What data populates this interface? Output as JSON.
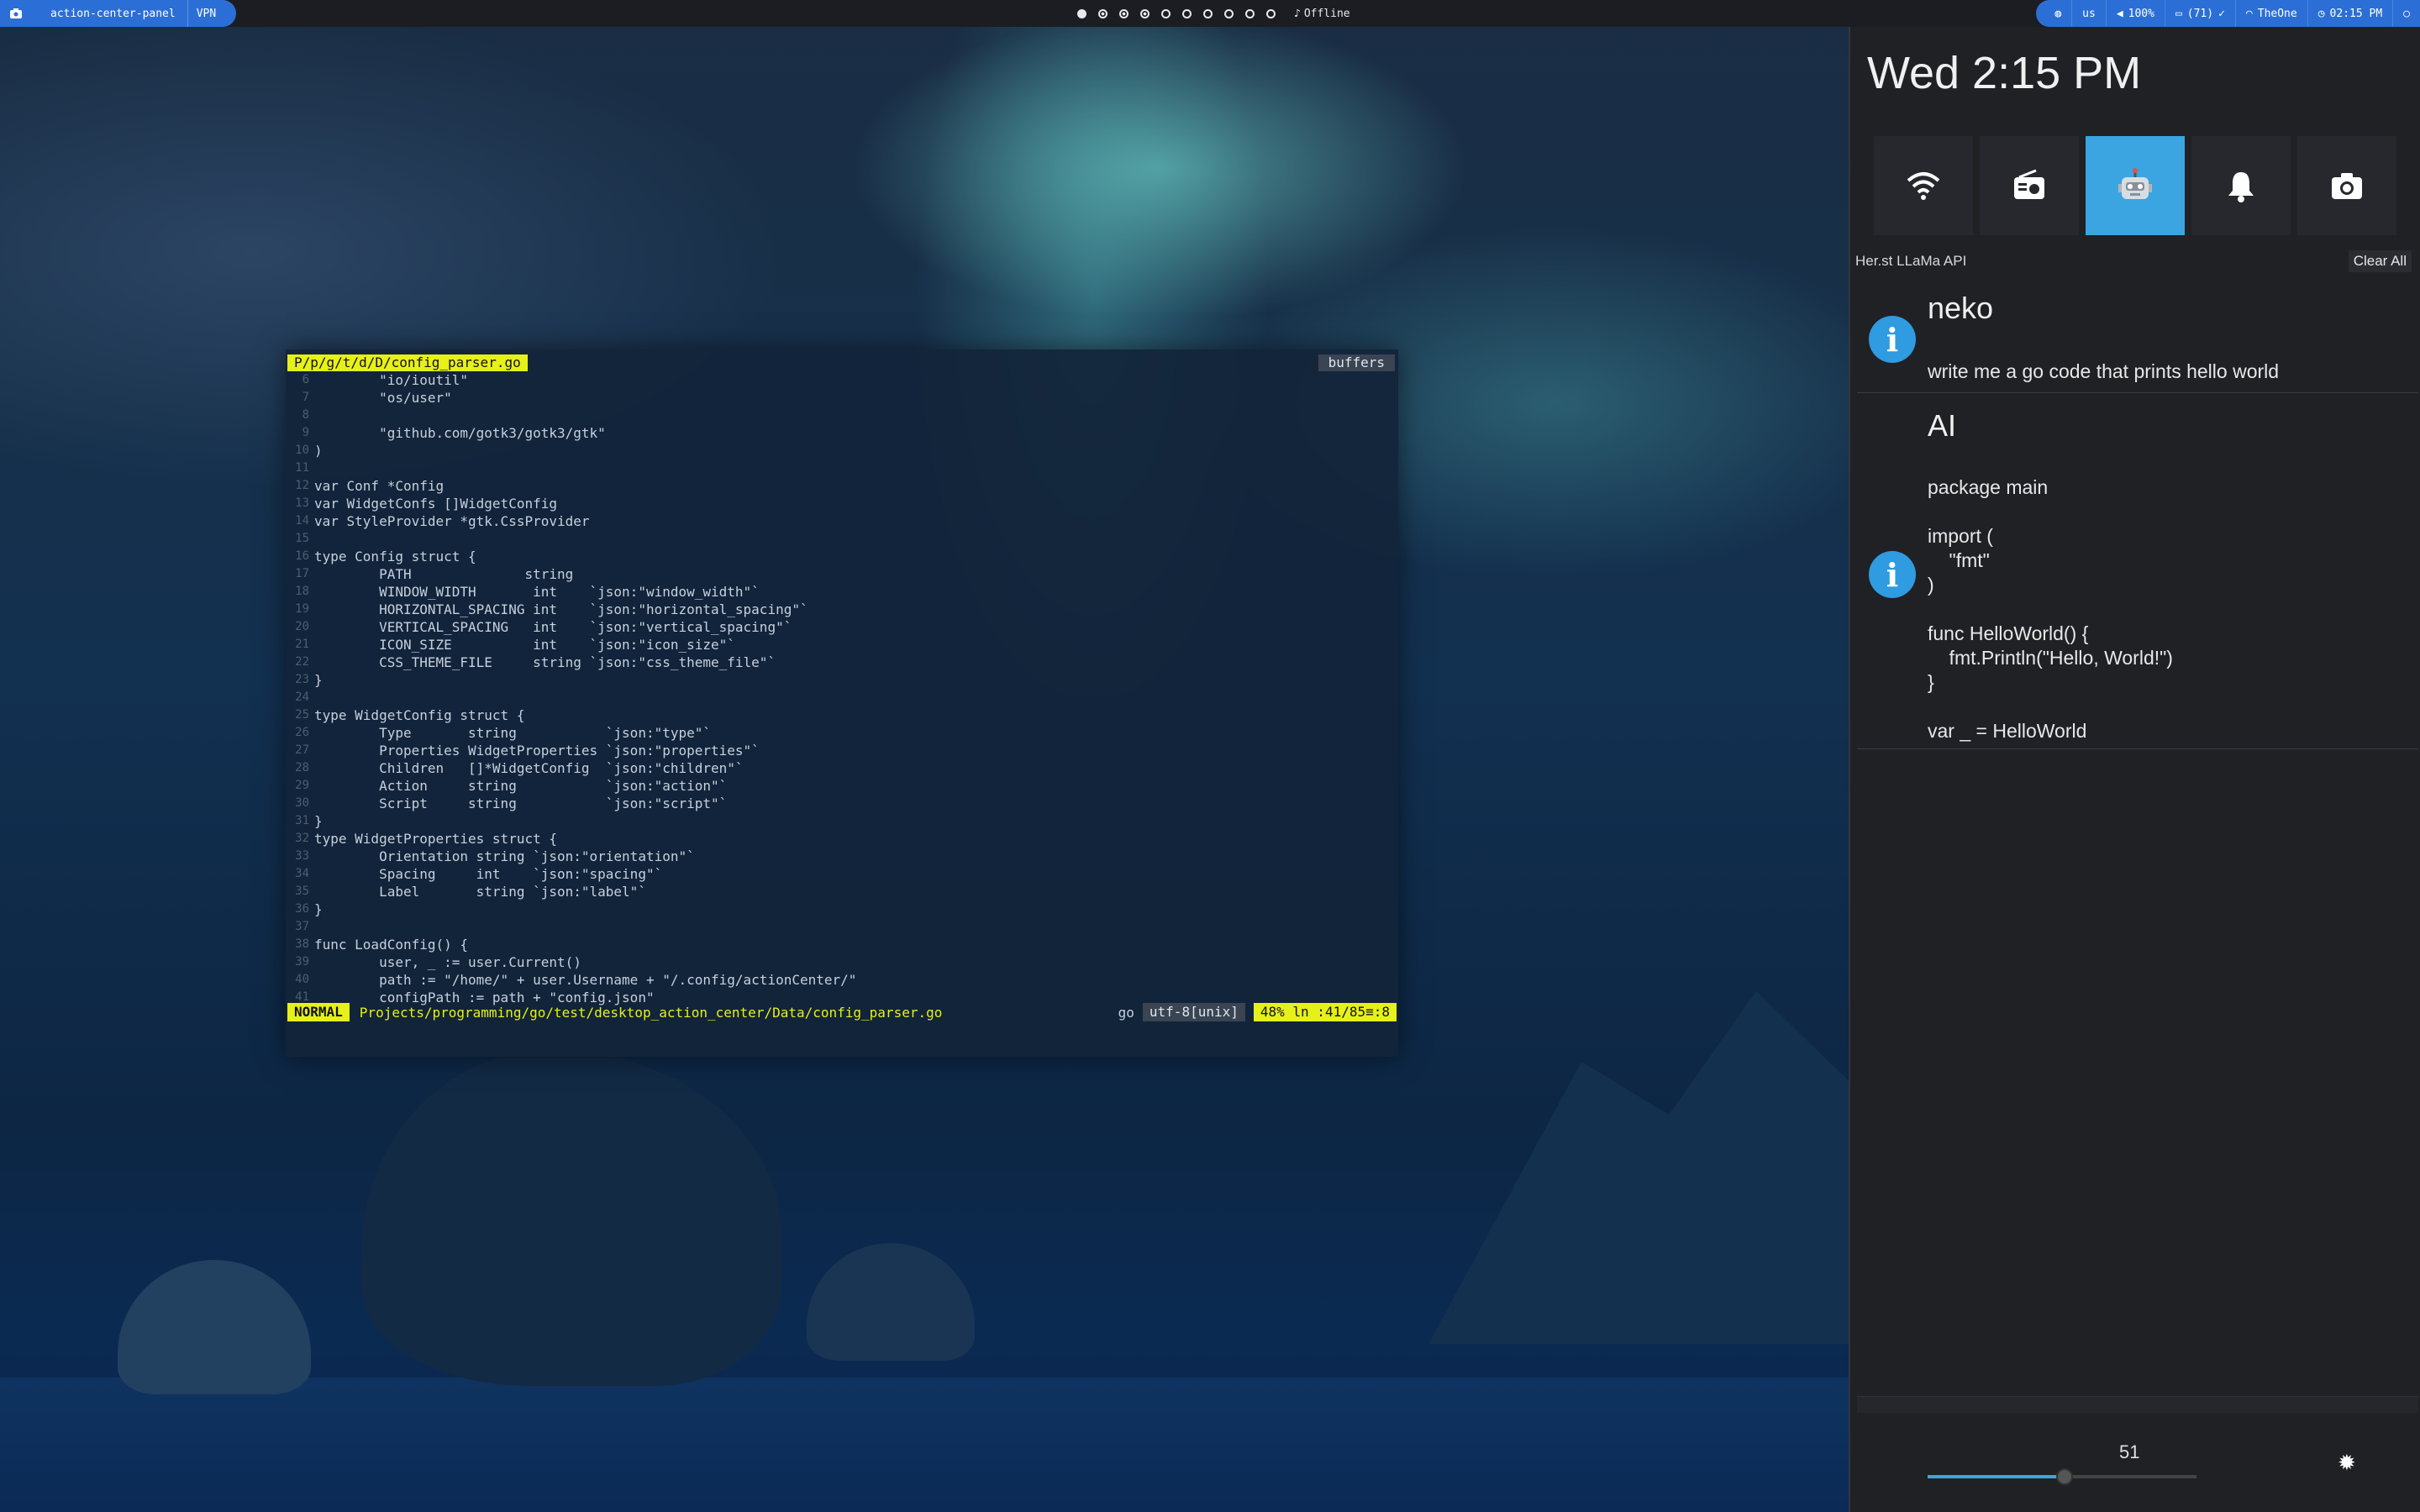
{
  "topbar": {
    "app_name": "action-center-panel",
    "vpn": "VPN",
    "workspaces": [
      {
        "state": "active"
      },
      {
        "state": "busy"
      },
      {
        "state": "busy"
      },
      {
        "state": "busy"
      },
      {
        "state": "empty"
      },
      {
        "state": "empty"
      },
      {
        "state": "empty"
      },
      {
        "state": "empty"
      },
      {
        "state": "empty"
      },
      {
        "state": "empty"
      }
    ],
    "media_status": "Offline",
    "status": {
      "keyboard": "us",
      "volume": "100%",
      "battery": "(71)",
      "network": "TheOne",
      "time": "02:15 PM"
    }
  },
  "editor": {
    "tab_path": "P/p/g/t/d/D/config_parser.go",
    "buffers_label": "buffers",
    "lines": [
      {
        "n": "6",
        "t": "        \"io/ioutil\""
      },
      {
        "n": "7",
        "t": "        \"os/user\""
      },
      {
        "n": "8",
        "t": ""
      },
      {
        "n": "9",
        "t": "        \"github.com/gotk3/gotk3/gtk\""
      },
      {
        "n": "10",
        "t": ")"
      },
      {
        "n": "11",
        "t": ""
      },
      {
        "n": "12",
        "t": "var Conf *Config"
      },
      {
        "n": "13",
        "t": "var WidgetConfs []WidgetConfig"
      },
      {
        "n": "14",
        "t": "var StyleProvider *gtk.CssProvider"
      },
      {
        "n": "15",
        "t": ""
      },
      {
        "n": "16",
        "t": "type Config struct {"
      },
      {
        "n": "17",
        "t": "        PATH              string"
      },
      {
        "n": "18",
        "t": "        WINDOW_WIDTH       int    `json:\"window_width\"`"
      },
      {
        "n": "19",
        "t": "        HORIZONTAL_SPACING int    `json:\"horizontal_spacing\"`"
      },
      {
        "n": "20",
        "t": "        VERTICAL_SPACING   int    `json:\"vertical_spacing\"`"
      },
      {
        "n": "21",
        "t": "        ICON_SIZE          int    `json:\"icon_size\"`"
      },
      {
        "n": "22",
        "t": "        CSS_THEME_FILE     string `json:\"css_theme_file\"`"
      },
      {
        "n": "23",
        "t": "}"
      },
      {
        "n": "24",
        "t": ""
      },
      {
        "n": "25",
        "t": "type WidgetConfig struct {"
      },
      {
        "n": "26",
        "t": "        Type       string           `json:\"type\"`"
      },
      {
        "n": "27",
        "t": "        Properties WidgetProperties `json:\"properties\"`"
      },
      {
        "n": "28",
        "t": "        Children   []*WidgetConfig  `json:\"children\"`"
      },
      {
        "n": "29",
        "t": "        Action     string           `json:\"action\"`"
      },
      {
        "n": "30",
        "t": "        Script     string           `json:\"script\"`"
      },
      {
        "n": "31",
        "t": "}"
      },
      {
        "n": "32",
        "t": "type WidgetProperties struct {"
      },
      {
        "n": "33",
        "t": "        Orientation string `json:\"orientation\"`"
      },
      {
        "n": "34",
        "t": "        Spacing     int    `json:\"spacing\"`"
      },
      {
        "n": "35",
        "t": "        Label       string `json:\"label\"`"
      },
      {
        "n": "36",
        "t": "}"
      },
      {
        "n": "37",
        "t": ""
      },
      {
        "n": "38",
        "t": "func LoadConfig() {"
      },
      {
        "n": "39",
        "t": "        user, _ := user.Current()"
      },
      {
        "n": "40",
        "t": "        path := \"/home/\" + user.Username + \"/.config/actionCenter/\""
      },
      {
        "n": "41",
        "t": "        configPath := path + \"config.json\""
      }
    ],
    "status": {
      "mode": "NORMAL",
      "path": "Projects/programming/go/test/desktop_action_center/Data/config_parser.go",
      "filetype": "go",
      "encoding": "utf-8[unix]",
      "position": "48%  ln :41/85≡:8"
    }
  },
  "panel": {
    "clock": "Wed 2:15 PM",
    "quick_toggles": [
      {
        "icon": "wifi-icon",
        "active": false
      },
      {
        "icon": "radio-icon",
        "active": false
      },
      {
        "icon": "robot-icon",
        "active": true
      },
      {
        "icon": "bell-icon",
        "active": false
      },
      {
        "icon": "camera-icon",
        "active": false
      }
    ],
    "notification_source": "Her.st LLaMa API",
    "clear_all": "Clear All",
    "notifications": [
      {
        "title": "neko",
        "body": "write me a go code that prints hello world"
      },
      {
        "title": "AI",
        "body": "package main\n\nimport (\n    \"fmt\"\n)\n\nfunc HelloWorld() {\n    fmt.Println(\"Hello, World!\")\n}\n\nvar _ = HelloWorld"
      }
    ],
    "volume": {
      "value": "51",
      "fraction": 0.51
    }
  }
}
